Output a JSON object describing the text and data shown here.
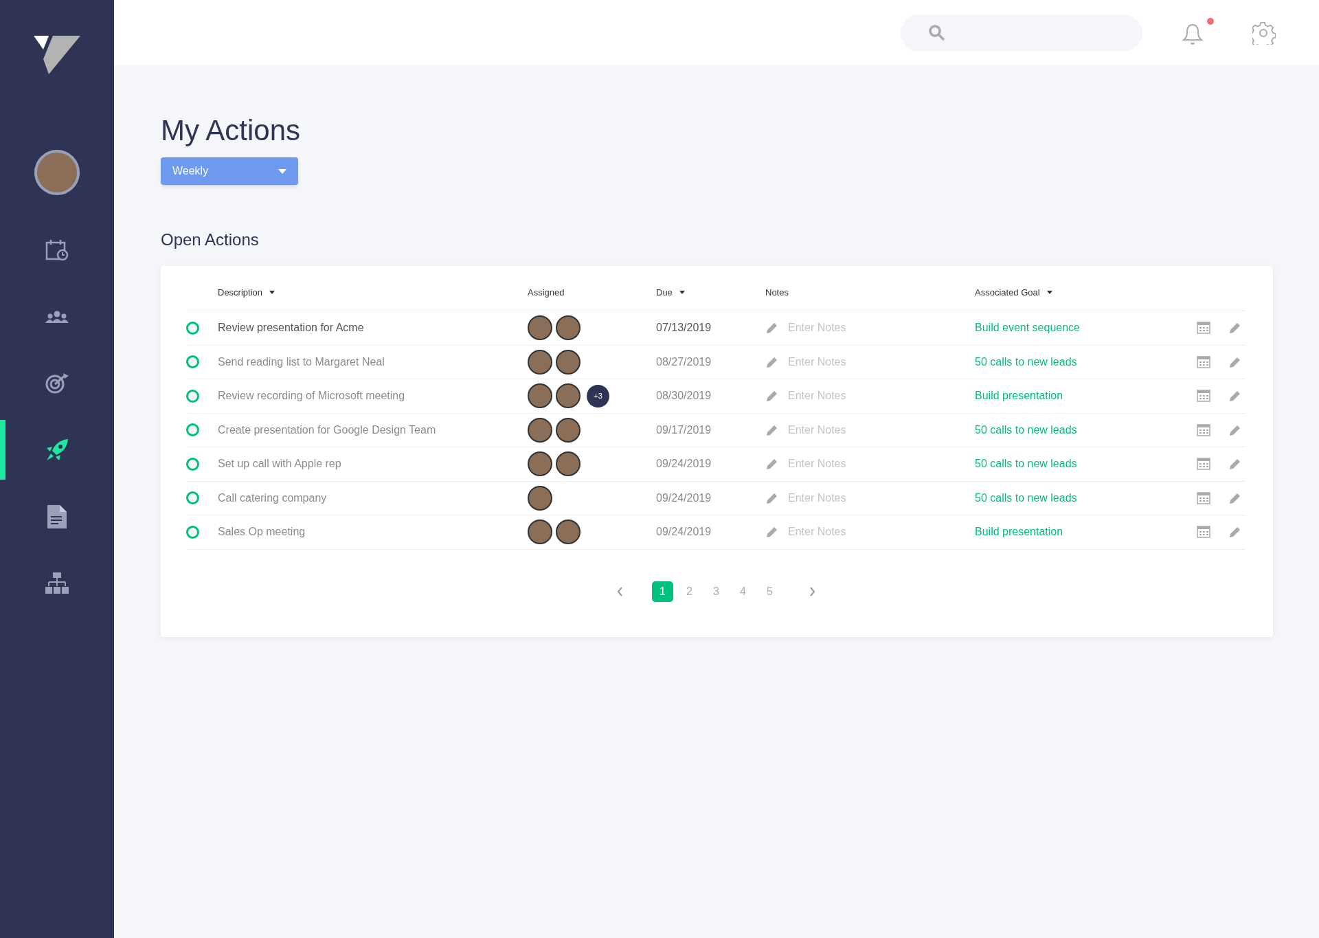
{
  "sidebar": {
    "items": [
      {
        "kind": "calendar",
        "selected": false
      },
      {
        "kind": "team",
        "selected": false
      },
      {
        "kind": "target",
        "selected": false
      },
      {
        "kind": "rocket",
        "selected": true
      },
      {
        "kind": "document",
        "selected": false
      },
      {
        "kind": "hierarchy",
        "selected": false
      }
    ]
  },
  "header": {
    "notification_unread": true
  },
  "page": {
    "title": "My Actions",
    "period": "Weekly",
    "section_title": "Open Actions"
  },
  "table": {
    "columns": [
      {
        "label": "Description",
        "sortable": true
      },
      {
        "label": "Assigned",
        "sortable": false
      },
      {
        "label": "Due",
        "sortable": true
      },
      {
        "label": "Notes",
        "sortable": false
      },
      {
        "label": "Associated Goal",
        "sortable": true
      }
    ],
    "rows": [
      {
        "description": "Review presentation for Acme",
        "checked": false,
        "highlighted": true,
        "assignees": [
          {
            "kind": "person"
          },
          {
            "kind": "person"
          }
        ],
        "due": "07/13/2019",
        "notes_placeholder": "Enter Notes",
        "goal": "Build event sequence"
      },
      {
        "description": "Send reading list to Margaret Neal",
        "checked": false,
        "highlighted": false,
        "assignees": [
          {
            "kind": "person"
          },
          {
            "kind": "person"
          }
        ],
        "due": "08/27/2019",
        "notes_placeholder": "Enter Notes",
        "goal": "50 calls to new leads"
      },
      {
        "description": "Review recording of Microsoft meeting",
        "checked": false,
        "highlighted": false,
        "assignees": [
          {
            "kind": "person"
          },
          {
            "kind": "person"
          }
        ],
        "more": "+3",
        "due": "08/30/2019",
        "notes_placeholder": "Enter Notes",
        "goal": "Build presentation"
      },
      {
        "description": "Create presentation for Google Design Team",
        "checked": false,
        "highlighted": false,
        "assignees": [
          {
            "kind": "person"
          },
          {
            "kind": "person"
          }
        ],
        "due": "09/17/2019",
        "notes_placeholder": "Enter Notes",
        "goal": "50 calls to new leads"
      },
      {
        "description": "Set up call with Apple rep",
        "checked": false,
        "highlighted": false,
        "assignees": [
          {
            "kind": "person"
          },
          {
            "kind": "person"
          }
        ],
        "due": "09/24/2019",
        "notes_placeholder": "Enter Notes",
        "goal": "50 calls to new leads"
      },
      {
        "description": "Call catering company",
        "checked": false,
        "highlighted": false,
        "assignees": [
          {
            "kind": "person"
          }
        ],
        "due": "09/24/2019",
        "notes_placeholder": "Enter Notes",
        "goal": "50 calls to new leads"
      },
      {
        "description": "Sales Op meeting",
        "checked": false,
        "highlighted": false,
        "assignees": [
          {
            "kind": "person"
          },
          {
            "kind": "person"
          }
        ],
        "due": "09/24/2019",
        "notes_placeholder": "Enter Notes",
        "goal": "Build presentation"
      }
    ]
  },
  "pagination": {
    "pages": [
      {
        "label": "1",
        "selected": true
      },
      {
        "label": "2",
        "selected": false
      },
      {
        "label": "3",
        "selected": false
      },
      {
        "label": "4",
        "selected": false
      },
      {
        "label": "5",
        "selected": false
      }
    ]
  }
}
